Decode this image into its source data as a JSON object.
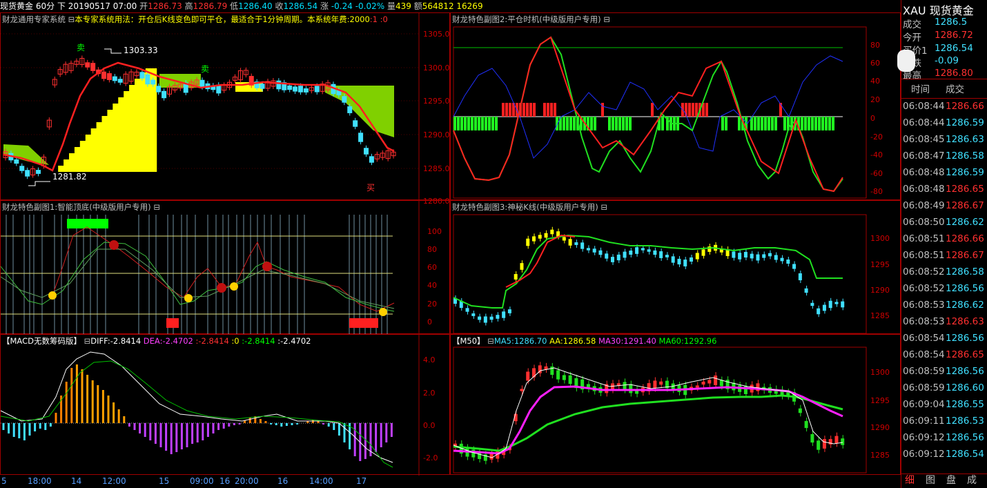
{
  "header": {
    "symbol": "现货黄金",
    "period": "60分",
    "mode": "下",
    "datetime": "20190517 07:00",
    "open_label": "开",
    "open": "1286.73",
    "high_label": "高",
    "high": "1286.79",
    "low_label": "低",
    "low": "1286.40",
    "close_label": "收",
    "close": "1286.54",
    "change_label": "涨",
    "change": "-0.24",
    "change_pct": "-0.02%",
    "vol_label": "量",
    "vol": "439",
    "amount_label": "额",
    "amount": "564812",
    "extra": "16269"
  },
  "panels": {
    "main": {
      "title_prefix": "财龙通用专家系统",
      "title_note": "本专家系统用法：开仓后K线变色即可平仓，最适合于1分钟周期。本系统年费:2000",
      "title_tail1": ":1",
      "title_tail2": ":0",
      "sell_label": "卖",
      "buy_label": "买",
      "high_mark": "1303.33",
      "low_mark": "1281.82",
      "yaxis": [
        "1305.0",
        "1300.0",
        "1295.0",
        "1290.0",
        "1285.0",
        "1280.0"
      ]
    },
    "sub1": {
      "title": "财龙特色副图1:智能顶底(中级版用户专用)",
      "yaxis": [
        "100",
        "80",
        "60",
        "40",
        "20",
        "0"
      ]
    },
    "sub2": {
      "title": "财龙特色副图2:平仓时机(中级版用户专用)",
      "yaxis": [
        "80",
        "60",
        "40",
        "20",
        "0",
        "-20",
        "-40",
        "-60",
        "-80"
      ]
    },
    "sub3": {
      "title": "财龙特色副图3:神秘K线(中级版用户专用)",
      "yaxis": [
        "1300",
        "1295",
        "1290",
        "1285"
      ]
    },
    "macd": {
      "title": "【MACD无数筹码版】",
      "diff_label": "DIFF:",
      "diff": "-2.8414",
      "dea_label": "DEA:",
      "dea": "-2.4702",
      "v1_label": ":",
      "v1": "-2.8414",
      "v2_label": ":0",
      "v3_label": ":",
      "v3": "-2.8414",
      "v4_label": ":",
      "v4": "-2.4702",
      "yaxis": [
        "4.0",
        "2.0",
        "0.0",
        "-2.0"
      ]
    },
    "ma": {
      "title": "【M50】",
      "ma5": "MA5:1286.70",
      "aa": "AA:1286.58",
      "ma30": "MA30:1291.40",
      "ma60": "MA60:1292.96",
      "yaxis": [
        "1300",
        "1295",
        "1290",
        "1285"
      ]
    }
  },
  "xaxis": [
    "5",
    "18:00",
    "14",
    "12:00",
    "15",
    "09:00",
    "16",
    "20:00",
    "16",
    "14:00",
    "17"
  ],
  "sidebar": {
    "code": "XAU",
    "name": "现货黄金",
    "quotes": [
      {
        "label": "成交",
        "value": "1286.5"
      },
      {
        "label": "今开",
        "value": "1286.72"
      },
      {
        "label": "买价1",
        "value": "1286.54"
      },
      {
        "label": "涨跌",
        "value": "-0.09"
      },
      {
        "label": "最高",
        "value": "1286.80"
      }
    ],
    "tick_header_time": "时间",
    "tick_header_price": "成交",
    "ticks": [
      {
        "t": "06:08:44",
        "p": "1286.66",
        "up": true
      },
      {
        "t": "06:08:44",
        "p": "1286.59",
        "up": false
      },
      {
        "t": "06:08:45",
        "p": "1286.63",
        "up": false
      },
      {
        "t": "06:08:47",
        "p": "1286.58",
        "up": false
      },
      {
        "t": "06:08:48",
        "p": "1286.59",
        "up": false
      },
      {
        "t": "06:08:48",
        "p": "1286.65",
        "up": true
      },
      {
        "t": "06:08:49",
        "p": "1286.67",
        "up": true
      },
      {
        "t": "06:08:50",
        "p": "1286.62",
        "up": false
      },
      {
        "t": "06:08:51",
        "p": "1286.66",
        "up": true
      },
      {
        "t": "06:08:51",
        "p": "1286.67",
        "up": true
      },
      {
        "t": "06:08:52",
        "p": "1286.58",
        "up": false
      },
      {
        "t": "06:08:52",
        "p": "1286.56",
        "up": false
      },
      {
        "t": "06:08:53",
        "p": "1286.62",
        "up": false
      },
      {
        "t": "06:08:53",
        "p": "1286.63",
        "up": true
      },
      {
        "t": "06:08:54",
        "p": "1286.56",
        "up": false
      },
      {
        "t": "06:08:54",
        "p": "1286.65",
        "up": true
      },
      {
        "t": "06:08:59",
        "p": "1286.56",
        "up": false
      },
      {
        "t": "06:08:59",
        "p": "1286.60",
        "up": false
      },
      {
        "t": "06:09:04",
        "p": "1286.55",
        "up": false
      },
      {
        "t": "06:09:11",
        "p": "1286.53",
        "up": false
      },
      {
        "t": "06:09:12",
        "p": "1286.56",
        "up": false
      },
      {
        "t": "06:09:12",
        "p": "1286.54",
        "up": false
      }
    ],
    "tabs": [
      "细",
      "图",
      "盘",
      "成"
    ]
  },
  "colors": {
    "up": "#ff3030",
    "down": "#40e0ff",
    "yellow": "#ffff00",
    "green": "#00ff00",
    "magenta": "#ff00ff",
    "frame": "#a00000"
  }
}
